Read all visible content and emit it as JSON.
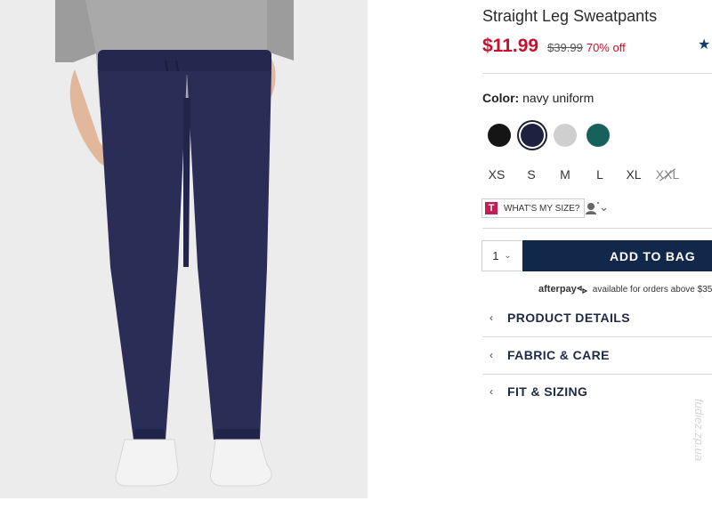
{
  "product": {
    "title": "Straight Leg Sweatpants",
    "price": "$11.99",
    "original_price": "$39.99",
    "discount": "70% off",
    "rating_icon": "star-icon"
  },
  "color": {
    "label": "Color:",
    "value": "navy uniform",
    "swatches": [
      {
        "name": "black",
        "hex": "#151515",
        "selected": false
      },
      {
        "name": "navy uniform",
        "hex": "#1f2140",
        "selected": true
      },
      {
        "name": "heather gray",
        "hex": "#cfcfcf",
        "selected": false
      },
      {
        "name": "teal",
        "hex": "#17615c",
        "selected": false
      }
    ]
  },
  "sizes": [
    {
      "label": "XS",
      "available": true
    },
    {
      "label": "S",
      "available": true
    },
    {
      "label": "M",
      "available": true
    },
    {
      "label": "L",
      "available": true
    },
    {
      "label": "XL",
      "available": true
    },
    {
      "label": "XXL",
      "available": false
    }
  ],
  "size_help": {
    "badge": "T",
    "label": "WHAT'S MY SIZE?",
    "avatar_icon": "avatar-dropdown-icon"
  },
  "cart": {
    "quantity": "1",
    "add_label": "ADD TO BAG"
  },
  "afterpay": {
    "brand": "afterpay",
    "text": "available for orders above $35"
  },
  "accordion": [
    {
      "label": "PRODUCT DETAILS"
    },
    {
      "label": "FABRIC & CARE"
    },
    {
      "label": "FIT & SIZING"
    }
  ],
  "watermark": "fudiez.zp.ua",
  "colors": {
    "price_red": "#c8102e",
    "button_navy": "#12284a",
    "pants_navy": "#2a2d56",
    "sweater_gray": "#a9a9a9"
  }
}
